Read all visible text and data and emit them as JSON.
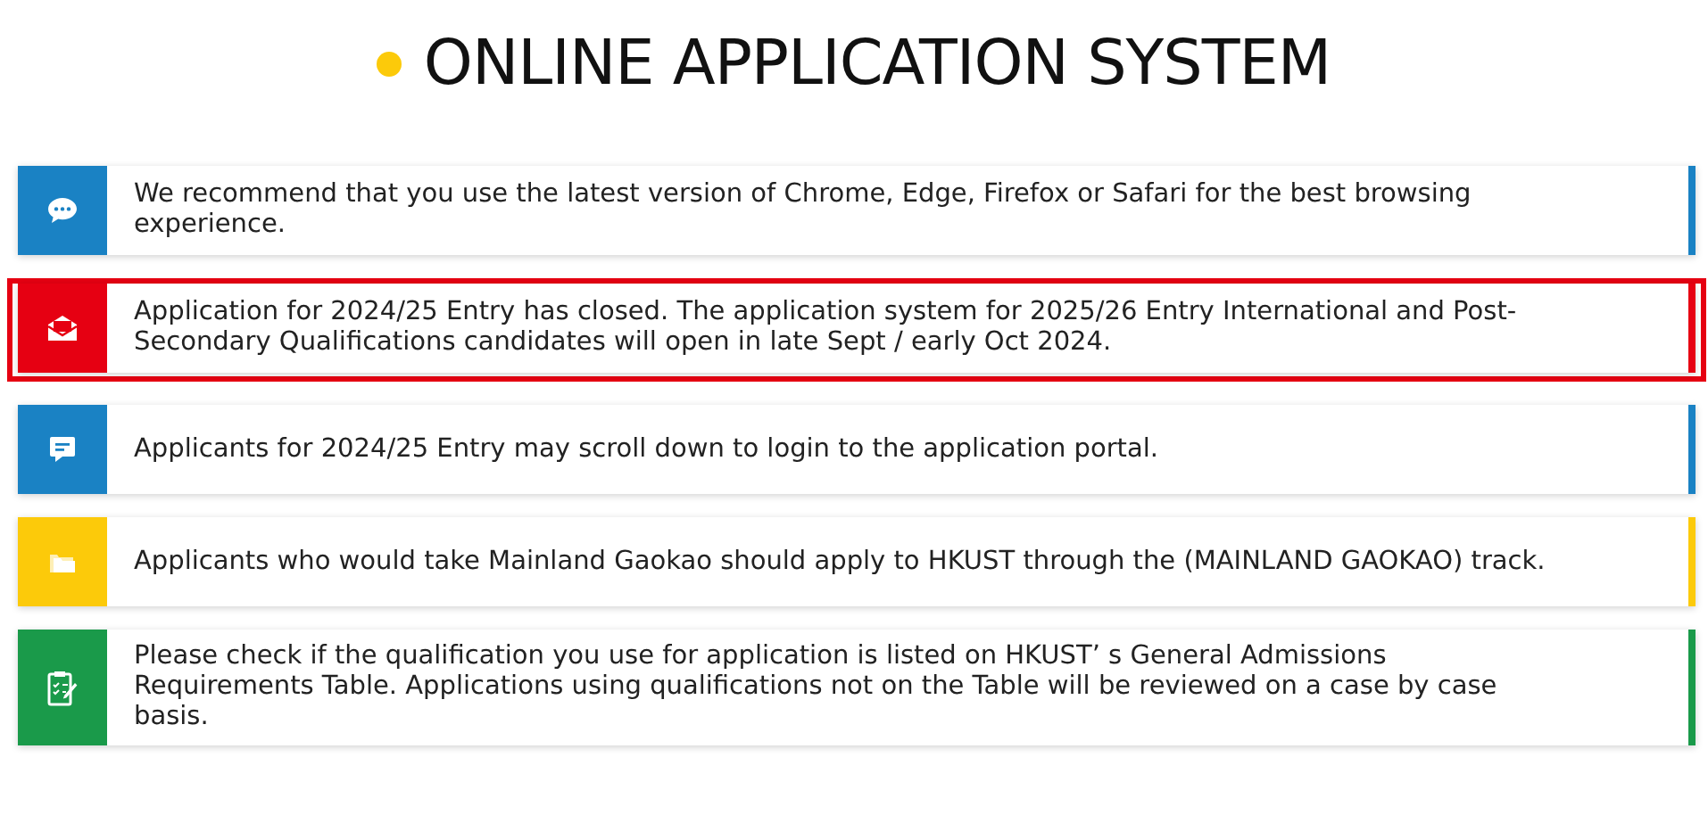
{
  "title": "ONLINE APPLICATION SYSTEM",
  "notices": [
    {
      "kind": "chat",
      "color": "#1a82c4",
      "highlighted": false,
      "text": "We recommend that you use the latest version of Chrome, Edge, Firefox or Safari for the best browsing experience."
    },
    {
      "kind": "mail",
      "color": "#e60012",
      "highlighted": true,
      "text": "Application for 2024/25 Entry has closed. The application system for 2025/26 Entry International and Post-Secondary Qualifications candidates will open in late Sept / early Oct 2024."
    },
    {
      "kind": "message",
      "color": "#1a82c4",
      "highlighted": false,
      "text": "Applicants for 2024/25 Entry may scroll down to login to the application portal."
    },
    {
      "kind": "folder",
      "color": "#fcca0a",
      "highlighted": false,
      "text": "Applicants who would take Mainland Gaokao should apply to HKUST through the (MAINLAND GAOKAO) track."
    },
    {
      "kind": "clipboard",
      "color": "#1a9a4a",
      "highlighted": false,
      "text": "Please check if the qualification you use for application is listed on HKUST’ s General Admissions Requirements Table. Applications using qualifications not on the Table will be reviewed on a case by case basis."
    }
  ]
}
